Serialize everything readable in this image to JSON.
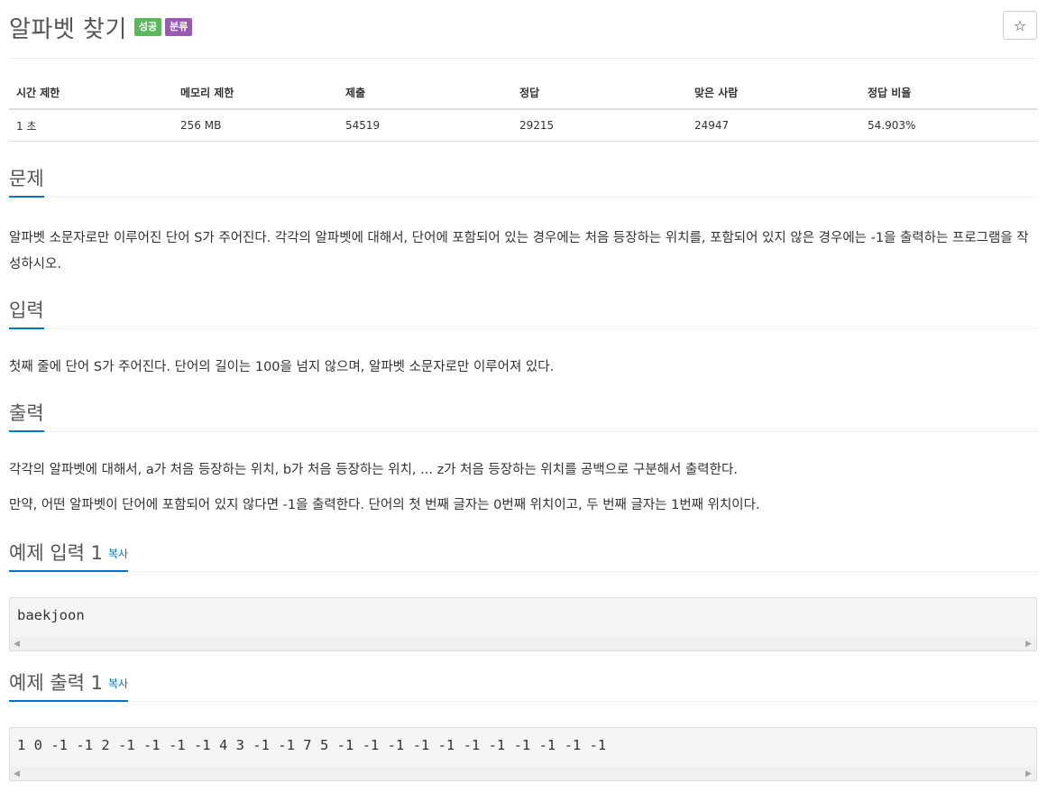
{
  "header": {
    "title": "알파벳 찾기",
    "badge_success": "성공",
    "badge_category": "분류",
    "star_icon": "☆"
  },
  "info_table": {
    "columns": [
      "시간 제한",
      "메모리 제한",
      "제출",
      "정답",
      "맞은 사람",
      "정답 비율"
    ],
    "values": [
      "1 초",
      "256 MB",
      "54519",
      "29215",
      "24947",
      "54.903%"
    ]
  },
  "problem": {
    "heading": "문제",
    "text": "알파벳 소문자로만 이루어진 단어 S가 주어진다. 각각의 알파벳에 대해서, 단어에 포함되어 있는 경우에는 처음 등장하는 위치를, 포함되어 있지 않은 경우에는 -1을 출력하는 프로그램을 작성하시오."
  },
  "input": {
    "heading": "입력",
    "text": "첫째 줄에 단어 S가 주어진다. 단어의 길이는 100을 넘지 않으며, 알파벳 소문자로만 이루어져 있다."
  },
  "output": {
    "heading": "출력",
    "text1": "각각의 알파벳에 대해서, a가 처음 등장하는 위치, b가 처음 등장하는 위치, ... z가 처음 등장하는 위치를 공백으로 구분해서 출력한다.",
    "text2": "만약, 어떤 알파벳이 단어에 포함되어 있지 않다면 -1을 출력한다. 단어의 첫 번째 글자는 0번째 위치이고, 두 번째 글자는 1번째 위치이다."
  },
  "sample_input": {
    "heading": "예제 입력 1",
    "copy": "복사",
    "content": "baekjoon"
  },
  "sample_output": {
    "heading": "예제 출력 1",
    "copy": "복사",
    "content": "1 0 -1 -1 2 -1 -1 -1 -1 4 3 -1 -1 7 5 -1 -1 -1 -1 -1 -1 -1 -1 -1 -1 -1"
  },
  "colors": {
    "accent": "#0076c0",
    "success": "#5cb85c",
    "category": "#9b59b6"
  }
}
